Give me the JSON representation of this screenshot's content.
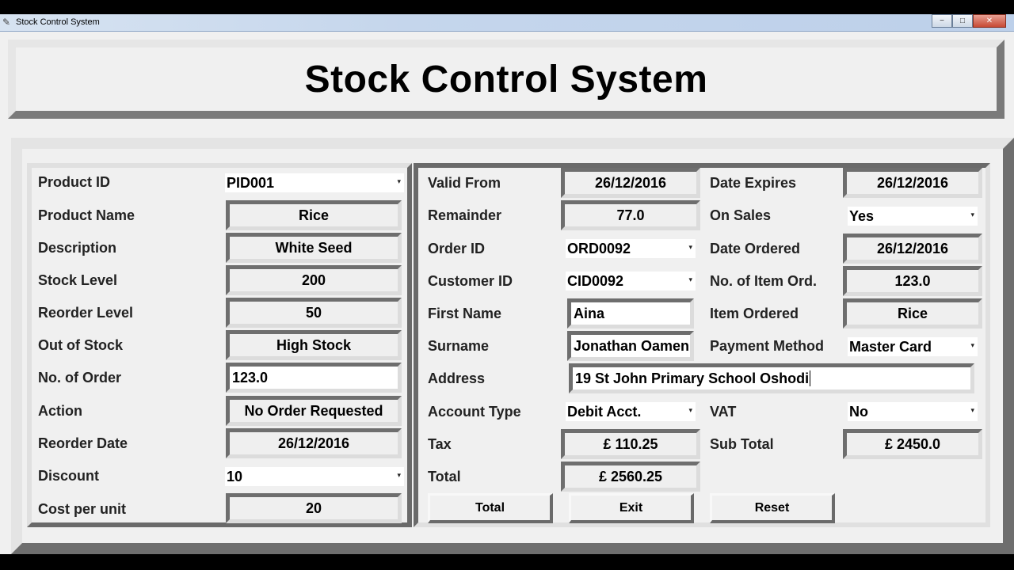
{
  "window": {
    "title": "Stock Control System",
    "buttons": {
      "minimize": "−",
      "maximize": "□",
      "close": "✕"
    },
    "app_icon": "feather-icon"
  },
  "header": {
    "title": "Stock Control System"
  },
  "left_panel": {
    "product_id": {
      "label": "Product ID",
      "value": "PID001"
    },
    "product_name": {
      "label": "Product Name",
      "value": "Rice"
    },
    "description": {
      "label": "Description",
      "value": "White Seed"
    },
    "stock_level": {
      "label": "Stock Level",
      "value": "200"
    },
    "reorder_level": {
      "label": "Reorder Level",
      "value": "50"
    },
    "out_of_stock": {
      "label": "Out of Stock",
      "value": "High Stock"
    },
    "no_of_order": {
      "label": "No. of Order",
      "value": "123.0"
    },
    "action": {
      "label": "Action",
      "value": "No Order Requested"
    },
    "reorder_date": {
      "label": "Reorder Date",
      "value": "26/12/2016"
    },
    "discount": {
      "label": "Discount",
      "value": "10"
    },
    "cost_per_unit": {
      "label": "Cost per unit",
      "value": "20"
    }
  },
  "right_panel": {
    "valid_from": {
      "label": "Valid From",
      "value": "26/12/2016"
    },
    "remainder": {
      "label": "Remainder",
      "value": "77.0"
    },
    "order_id": {
      "label": "Order ID",
      "value": "ORD0092"
    },
    "customer_id": {
      "label": "Customer ID",
      "value": "CID0092"
    },
    "first_name": {
      "label": "First Name",
      "value": "Aina"
    },
    "surname": {
      "label": "Surname",
      "value": "Jonathan Oamen"
    },
    "address": {
      "label": "Address",
      "value": "19 St John Primary School Oshodi"
    },
    "account_type": {
      "label": "Account Type",
      "value": "Debit Acct."
    },
    "tax": {
      "label": "Tax",
      "value": "£ 110.25"
    },
    "total": {
      "label": "Total",
      "value": "£ 2560.25"
    },
    "date_expires": {
      "label": "Date Expires",
      "value": "26/12/2016"
    },
    "on_sales": {
      "label": "On Sales",
      "value": "Yes"
    },
    "date_ordered": {
      "label": "Date Ordered",
      "value": "26/12/2016"
    },
    "no_of_item_ord": {
      "label": "No. of Item Ord.",
      "value": "123.0"
    },
    "item_ordered": {
      "label": "Item Ordered",
      "value": "Rice"
    },
    "payment_method": {
      "label": "Payment Method",
      "value": "Master Card"
    },
    "vat": {
      "label": "VAT",
      "value": "No"
    },
    "sub_total": {
      "label": "Sub Total",
      "value": "£ 2450.0"
    }
  },
  "buttons": {
    "total": "Total",
    "exit": "Exit",
    "reset": "Reset"
  },
  "icons": {
    "dropdown_arrow": "▾"
  }
}
